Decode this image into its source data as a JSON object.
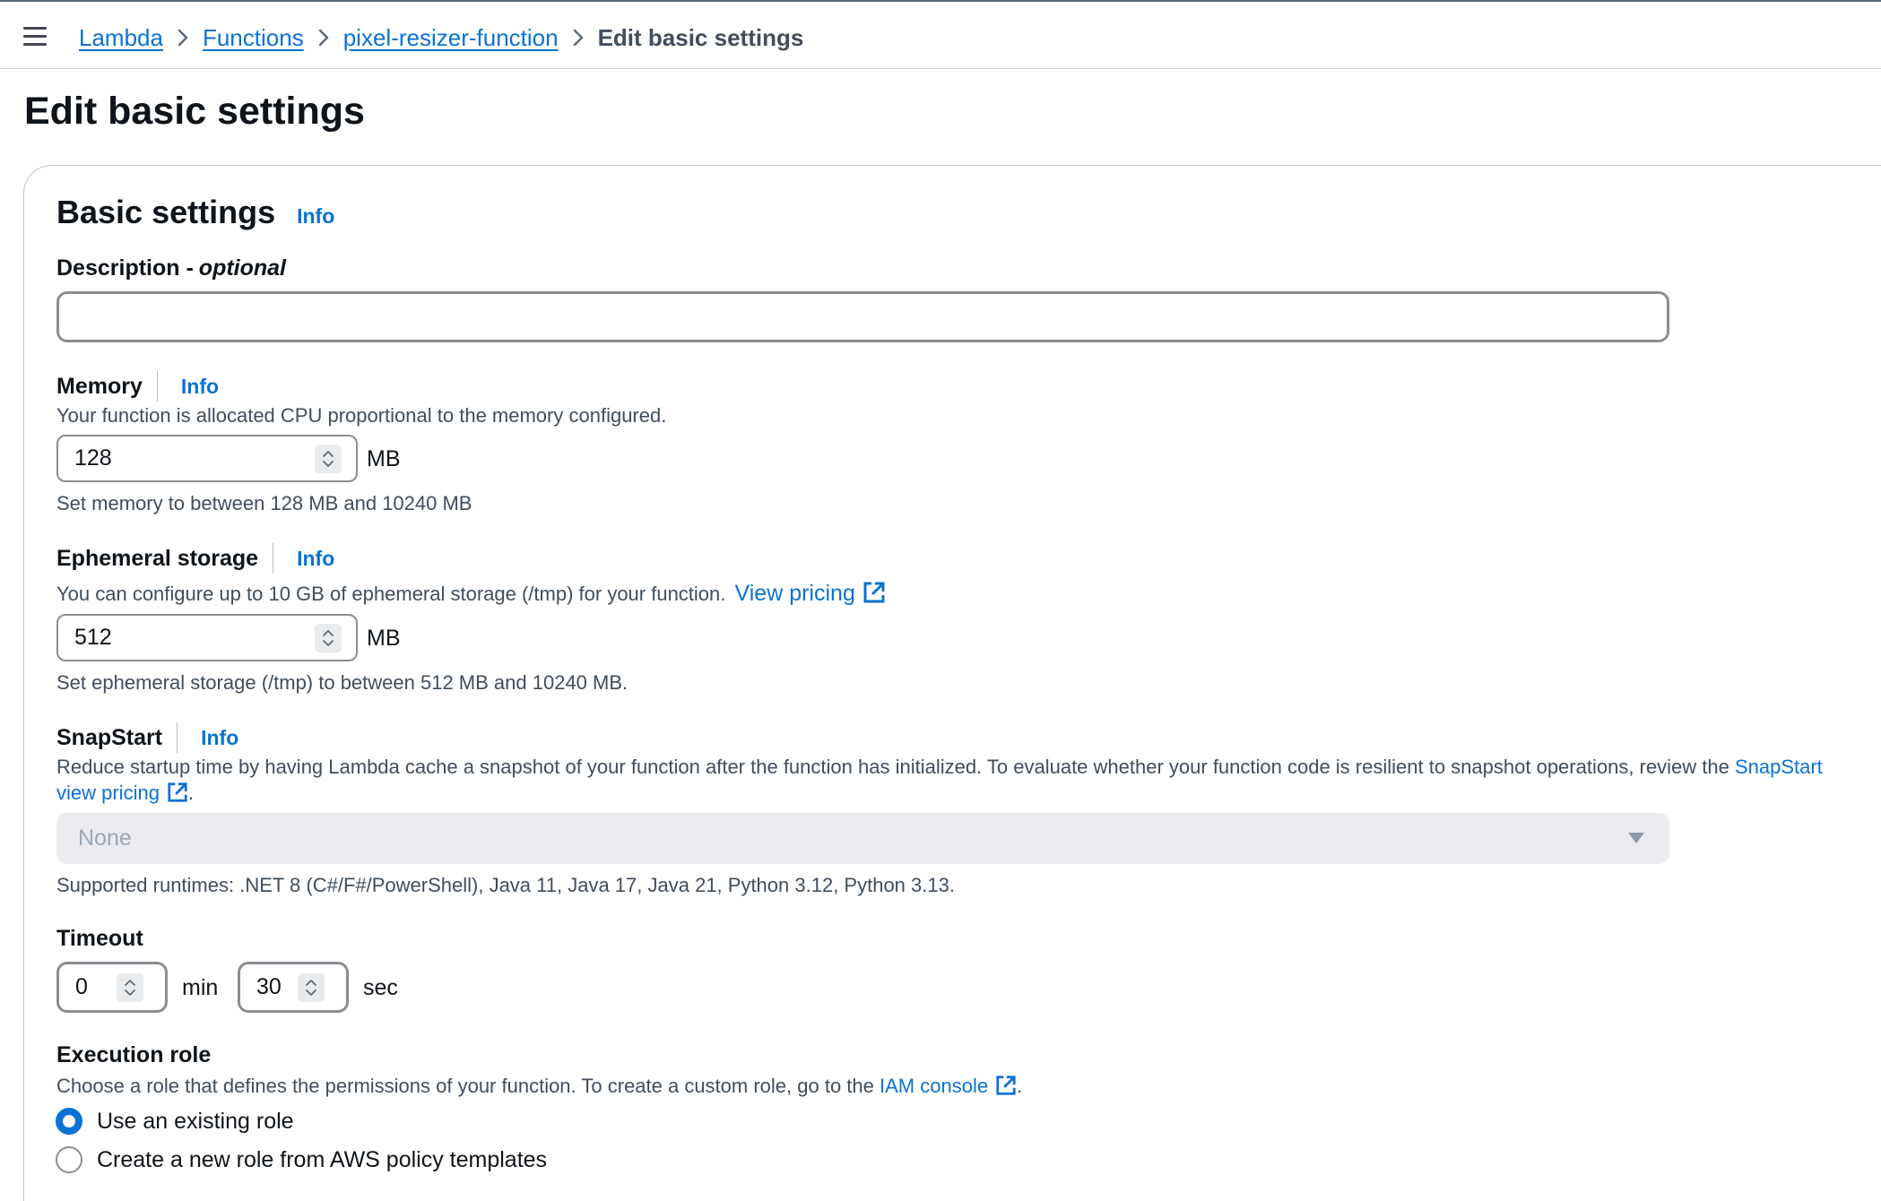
{
  "breadcrumb": {
    "items": [
      "Lambda",
      "Functions",
      "pixel-resizer-function"
    ],
    "current": "Edit basic settings"
  },
  "page": {
    "title": "Edit basic settings"
  },
  "basic_settings": {
    "title": "Basic settings",
    "info": "Info",
    "description": {
      "label": "Description - ",
      "label_optional": "optional",
      "value": ""
    },
    "memory": {
      "label": "Memory",
      "info": "Info",
      "description": "Your function is allocated CPU proportional to the memory configured.",
      "value": "128",
      "unit": "MB",
      "constraint": "Set memory to between 128 MB and 10240 MB"
    },
    "ephemeral_storage": {
      "label": "Ephemeral storage",
      "info": "Info",
      "description": "You can configure up to 10 GB of ephemeral storage (/tmp) for your function.",
      "link": "View pricing",
      "value": "512",
      "unit": "MB",
      "constraint": "Set ephemeral storage (/tmp) to between 512 MB and 10240 MB."
    },
    "snapstart": {
      "label": "SnapStart",
      "info": "Info",
      "description": "Reduce startup time by having Lambda cache a snapshot of your function after the function has initialized. To evaluate whether your function code is resilient to snapshot operations, review the",
      "link1": "SnapStart",
      "link2": "view pricing",
      "link2_suffix": ".",
      "selected": "None",
      "constraint": "Supported runtimes: .NET 8 (C#/F#/PowerShell), Java 11, Java 17, Java 21, Python 3.12, Python 3.13."
    },
    "timeout": {
      "label": "Timeout",
      "minutes": "0",
      "min_unit": "min",
      "seconds": "30",
      "sec_unit": "sec"
    },
    "execution_role": {
      "label": "Execution role",
      "description": "Choose a role that defines the permissions of your function. To create a custom role, go to the",
      "link": "IAM console",
      "link_suffix": ".",
      "options": [
        "Use an existing role",
        "Create a new role from AWS policy templates"
      ],
      "selected_index": 0
    }
  },
  "colors": {
    "link": "#0972d3",
    "text": "#0f141a",
    "muted": "#414d5c",
    "border": "#8c8c94"
  },
  "icons": [
    "menu-icon",
    "chevron-right-icon",
    "external-link-icon",
    "caret-down-icon",
    "stepper-icon"
  ]
}
